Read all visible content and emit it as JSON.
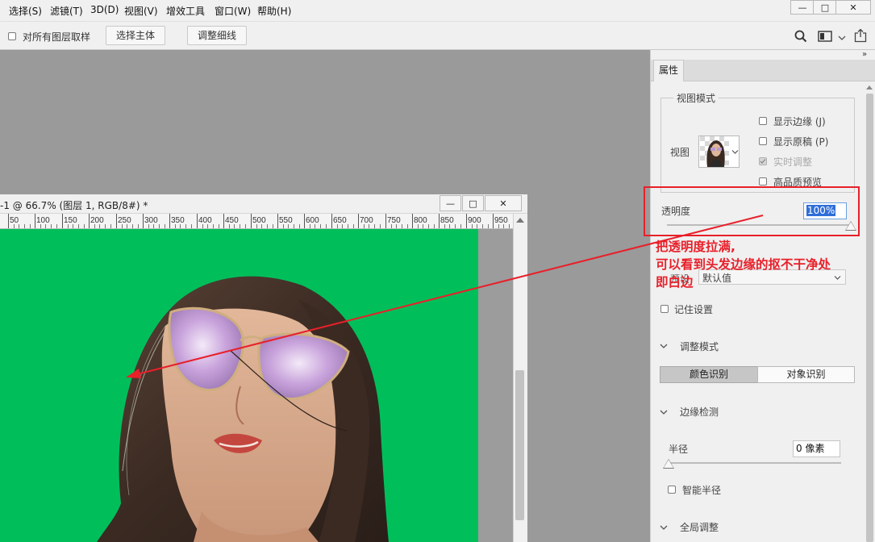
{
  "menu": {
    "items": [
      "选择(S)",
      "滤镜(T)",
      "3D(D)",
      "视图(V)",
      "增效工具",
      "窗口(W)",
      "帮助(H)"
    ],
    "window_controls": {
      "minimize": "—",
      "maximize": "□",
      "close": "✕"
    }
  },
  "options_bar": {
    "sample_all_layers_label": "对所有图层取样",
    "select_subject_label": "选择主体",
    "refine_hair_label": "调整细线",
    "icons": [
      "search-icon",
      "workspace-icon",
      "chevron-down-icon",
      "share-icon"
    ]
  },
  "document": {
    "title": "-1 @ 66.7% (图层 1, RGB/8#) *",
    "window_controls": {
      "minimize": "—",
      "maximize": "□",
      "close": "✕"
    },
    "ruler_labels": [
      "50",
      "100",
      "150",
      "200",
      "250",
      "300",
      "350",
      "400",
      "450",
      "500",
      "550",
      "600",
      "650",
      "700",
      "750",
      "800",
      "850",
      "900",
      "950"
    ],
    "canvas_background_color": "#00bf5a"
  },
  "properties": {
    "collapse_icon": "»",
    "tab_label": "属性",
    "view_mode": {
      "legend": "视图模式",
      "view_label": "视图",
      "show_edge_label": "显示边缘 (J)",
      "show_original_label": "显示原稿 (P)",
      "realtime_label": "实时调整",
      "high_quality_label": "高品质预览"
    },
    "opacity": {
      "label": "透明度",
      "value": "100%",
      "slider_percent": 100
    },
    "preset": {
      "label": "预设",
      "value": "默认值"
    },
    "remember_label": "记住设置",
    "adjust_mode": {
      "header": "调整模式",
      "color_aware_label": "颜色识别",
      "object_aware_label": "对象识别"
    },
    "edge_detection": {
      "header": "边缘检测",
      "radius_label": "半径",
      "radius_value": "0 像素",
      "radius_slider_percent": 0,
      "smart_radius_label": "智能半径"
    },
    "global_refine": {
      "header": "全局调整"
    }
  },
  "annotation": {
    "lines": [
      "把透明度拉满,",
      "可以看到头发边缘的抠不干净处",
      "即白边"
    ],
    "color": "#e8202a"
  }
}
